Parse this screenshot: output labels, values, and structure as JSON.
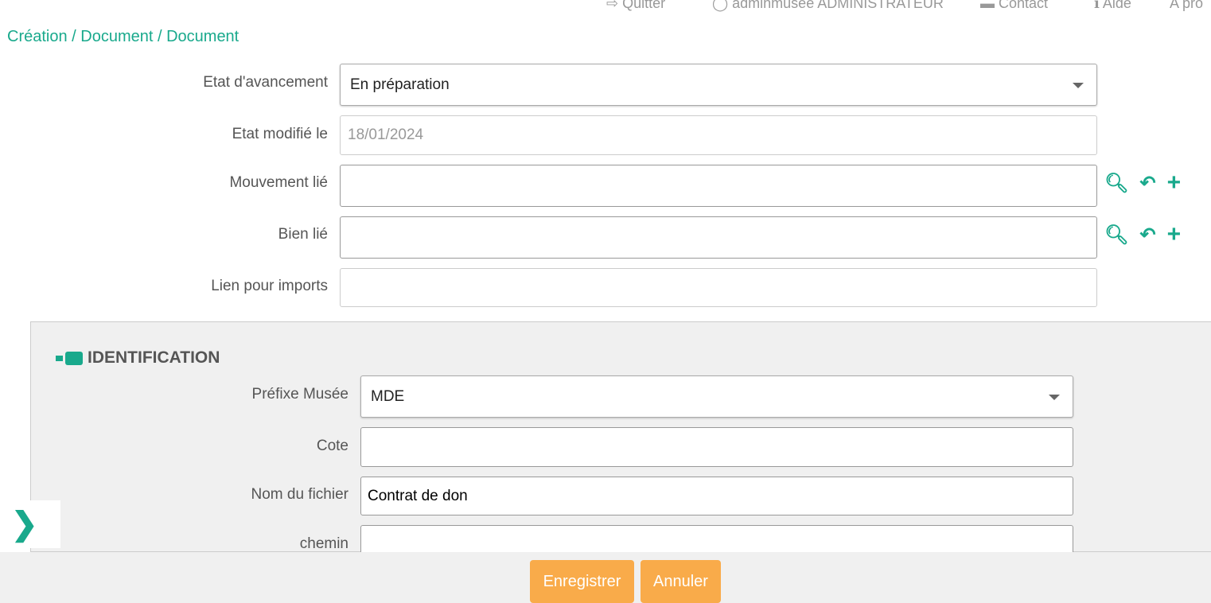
{
  "topbar": {
    "quit": "Quitter",
    "user": "adminmusee ADMINISTRATEUR",
    "contact": "Contact",
    "help": "Aide",
    "about": "A pro"
  },
  "breadcrumb": "Création / Document / Document",
  "fields": {
    "etat_label": "Etat d'avancement",
    "etat_value": "En préparation",
    "modif_label": "Etat modifié le",
    "modif_value": "18/01/2024",
    "mouvement_label": "Mouvement lié",
    "mouvement_value": "",
    "bien_label": "Bien lié",
    "bien_value": "",
    "lien_label": "Lien pour imports",
    "lien_value": ""
  },
  "identification": {
    "title": "IDENTIFICATION",
    "prefixe_label": "Préfixe Musée",
    "prefixe_value": "MDE",
    "cote_label": "Cote",
    "cote_value": "",
    "nom_label": "Nom du fichier",
    "nom_value": "Contrat de don",
    "chemin_label": "chemin",
    "chemin_value": ""
  },
  "buttons": {
    "save": "Enregistrer",
    "cancel": "Annuler"
  },
  "colors": {
    "accent": "#19a98c",
    "button": "#f9ab4a"
  }
}
